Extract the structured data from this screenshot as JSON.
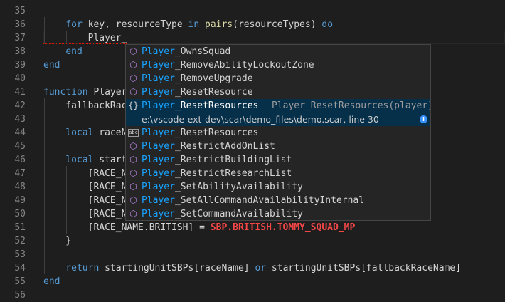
{
  "editor": {
    "lines": [
      {
        "no": "35",
        "segs": []
      },
      {
        "no": "36",
        "segs": [
          {
            "t": "    ",
            "c": "plain"
          },
          {
            "t": "for",
            "c": "kw"
          },
          {
            "t": " key, resourceType ",
            "c": "plain"
          },
          {
            "t": "in",
            "c": "kw"
          },
          {
            "t": " ",
            "c": "plain"
          },
          {
            "t": "pairs",
            "c": "fn"
          },
          {
            "t": "(resourceTypes) ",
            "c": "plain"
          },
          {
            "t": "do",
            "c": "kw"
          }
        ]
      },
      {
        "no": "37",
        "segs": [
          {
            "t": "        Player_",
            "c": "plain squiggle"
          }
        ]
      },
      {
        "no": "38",
        "segs": [
          {
            "t": "    ",
            "c": "plain"
          },
          {
            "t": "end",
            "c": "kw"
          }
        ]
      },
      {
        "no": "39",
        "segs": [
          {
            "t": "end",
            "c": "kw"
          }
        ]
      },
      {
        "no": "40",
        "segs": []
      },
      {
        "no": "41",
        "segs": [
          {
            "t": "function",
            "c": "kw"
          },
          {
            "t": " Player",
            "c": "plain"
          }
        ]
      },
      {
        "no": "42",
        "segs": [
          {
            "t": "    fallbackRac",
            "c": "plain"
          }
        ]
      },
      {
        "no": "43",
        "segs": []
      },
      {
        "no": "44",
        "segs": [
          {
            "t": "    ",
            "c": "plain"
          },
          {
            "t": "local",
            "c": "kw"
          },
          {
            "t": " raceN",
            "c": "plain"
          }
        ]
      },
      {
        "no": "45",
        "segs": []
      },
      {
        "no": "46",
        "segs": [
          {
            "t": "    ",
            "c": "plain"
          },
          {
            "t": "local",
            "c": "kw"
          },
          {
            "t": " start",
            "c": "plain"
          }
        ]
      },
      {
        "no": "47",
        "segs": [
          {
            "t": "        [RACE_N",
            "c": "plain"
          }
        ]
      },
      {
        "no": "48",
        "segs": [
          {
            "t": "        [RACE_N",
            "c": "plain"
          }
        ]
      },
      {
        "no": "49",
        "segs": [
          {
            "t": "        [RACE_N",
            "c": "plain"
          },
          {
            "t": "                                        ",
            "c": "plain"
          },
          {
            "t": "MP",
            "c": "red"
          },
          {
            "t": ",",
            "c": "plain"
          }
        ]
      },
      {
        "no": "50",
        "segs": [
          {
            "t": "        [RACE_N",
            "c": "plain"
          }
        ]
      },
      {
        "no": "51",
        "segs": [
          {
            "t": "        [RACE_NAME.BRITISH] = ",
            "c": "plain"
          },
          {
            "t": "SBP.BRITISH.TOMMY_SQUAD_MP",
            "c": "red"
          }
        ]
      },
      {
        "no": "52",
        "segs": [
          {
            "t": "    }",
            "c": "plain"
          }
        ]
      },
      {
        "no": "53",
        "segs": []
      },
      {
        "no": "54",
        "segs": [
          {
            "t": "    ",
            "c": "plain"
          },
          {
            "t": "return",
            "c": "kw"
          },
          {
            "t": " startingUnitSBPs[raceName] ",
            "c": "plain"
          },
          {
            "t": "or",
            "c": "kw"
          },
          {
            "t": " startingUnitSBPs[fallbackRaceName]",
            "c": "plain"
          }
        ]
      },
      {
        "no": "55",
        "segs": [
          {
            "t": "end",
            "c": "kw"
          }
        ]
      },
      {
        "no": "56",
        "segs": []
      }
    ]
  },
  "suggest": {
    "prefix": "Player",
    "items": [
      {
        "icon": "cube-icon",
        "glyph": "⬡",
        "rest": "_OwnsSquad"
      },
      {
        "icon": "cube-icon",
        "glyph": "⬡",
        "rest": "_RemoveAbilityLockoutZone"
      },
      {
        "icon": "cube-icon",
        "glyph": "⬡",
        "rest": "_RemoveUpgrade"
      },
      {
        "icon": "cube-icon",
        "glyph": "⬡",
        "rest": "_ResetResource"
      },
      {
        "icon": "braces-icon",
        "glyph": "{}",
        "rest": "_ResetResources",
        "detail": "Player_ResetResources(player)",
        "selected": true
      },
      {
        "icon": "cube-icon",
        "glyph": "⬡",
        "rest": "_ResetResources"
      },
      {
        "icon": "cube-icon",
        "glyph": "⬡",
        "rest": "_RestrictAddOnList"
      },
      {
        "icon": "cube-icon",
        "glyph": "⬡",
        "rest": "_RestrictBuildingList"
      },
      {
        "icon": "cube-icon",
        "glyph": "⬡",
        "rest": "_RestrictResearchList"
      },
      {
        "icon": "cube-icon",
        "glyph": "⬡",
        "rest": "_SetAbilityAvailability"
      },
      {
        "icon": "cube-icon",
        "glyph": "⬡",
        "rest": "_SetAllCommandAvailabilityInternal"
      },
      {
        "icon": "cube-icon",
        "glyph": "⬡",
        "rest": "_SetCommandAvailability"
      }
    ],
    "doc": "e:\\vscode-ext-dev\\scar\\demo_files\\demo.scar, line 30",
    "info_glyph": "i",
    "abc_glyph": "abc",
    "abc_row": 5,
    "colors": {
      "highlight": "#18a3ff",
      "selected_bg": "#062f4a",
      "method_icon": "#b180d7"
    }
  }
}
